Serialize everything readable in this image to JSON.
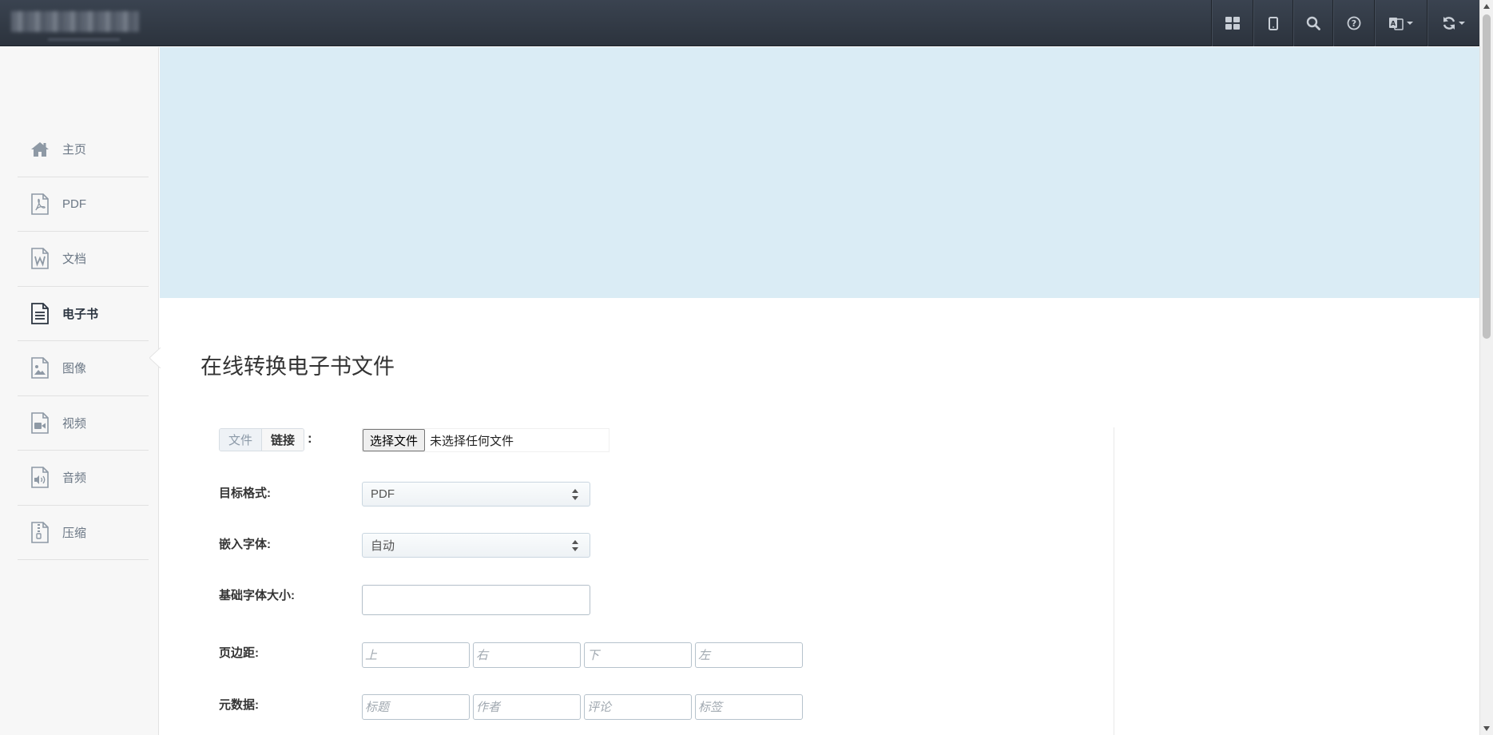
{
  "topbar": {
    "icons": [
      "grid-icon",
      "tablet-icon",
      "search-icon",
      "help-icon",
      "language-icon",
      "refresh-icon"
    ]
  },
  "sidebar": {
    "items": [
      {
        "label": "主页",
        "icon": "home-icon"
      },
      {
        "label": "PDF",
        "icon": "pdf-file-icon"
      },
      {
        "label": "文档",
        "icon": "word-file-icon"
      },
      {
        "label": "电子书",
        "icon": "ebook-file-icon",
        "active": true
      },
      {
        "label": "图像",
        "icon": "image-file-icon"
      },
      {
        "label": "视频",
        "icon": "video-file-icon"
      },
      {
        "label": "音频",
        "icon": "audio-file-icon"
      },
      {
        "label": "压缩",
        "icon": "archive-file-icon"
      }
    ]
  },
  "main": {
    "title": "在线转换电子书文件",
    "source": {
      "tab_file": "文件",
      "tab_link": "链接",
      "colon": ":",
      "file_button": "选择文件",
      "file_status": "未选择任何文件"
    },
    "target_format": {
      "label": "目标格式:",
      "value": "PDF"
    },
    "embed_font": {
      "label": "嵌入字体:",
      "value": "自动"
    },
    "base_font_size": {
      "label": "基础字体大小:",
      "value": ""
    },
    "margins": {
      "label": "页边距:",
      "placeholders": [
        "上",
        "右",
        "下",
        "左"
      ]
    },
    "metadata": {
      "label": "元数据:",
      "placeholders": [
        "标题",
        "作者",
        "评论",
        "标签"
      ]
    }
  },
  "colors": {
    "topbar": "#2f3640",
    "banner": "#daecf5",
    "sidebar": "#f7f7f7"
  }
}
